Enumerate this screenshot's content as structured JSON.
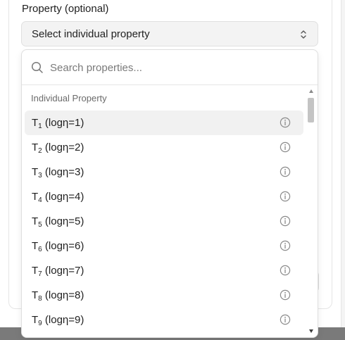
{
  "field": {
    "label": "Property (optional)",
    "selected": "Select individual property"
  },
  "dropdown": {
    "search_placeholder": "Search properties...",
    "group_heading": "Individual Property",
    "items": [
      {
        "base": "T",
        "sub": "1",
        "suffix": " (logη=1)"
      },
      {
        "base": "T",
        "sub": "2",
        "suffix": " (logη=2)"
      },
      {
        "base": "T",
        "sub": "3",
        "suffix": " (logη=3)"
      },
      {
        "base": "T",
        "sub": "4",
        "suffix": " (logη=4)"
      },
      {
        "base": "T",
        "sub": "5",
        "suffix": " (logη=5)"
      },
      {
        "base": "T",
        "sub": "6",
        "suffix": " (logη=6)"
      },
      {
        "base": "T",
        "sub": "7",
        "suffix": " (logη=7)"
      },
      {
        "base": "T",
        "sub": "8",
        "suffix": " (logη=8)"
      },
      {
        "base": "T",
        "sub": "9",
        "suffix": " (logη=9)"
      }
    ]
  },
  "icons": {
    "search": "search-icon",
    "chevron": "chevron-up-down-icon",
    "info": "info-icon"
  },
  "colors": {
    "active_row": "#f1f1f1",
    "select_bg": "#f3f3f3",
    "muted_text": "#6b6b6b"
  }
}
